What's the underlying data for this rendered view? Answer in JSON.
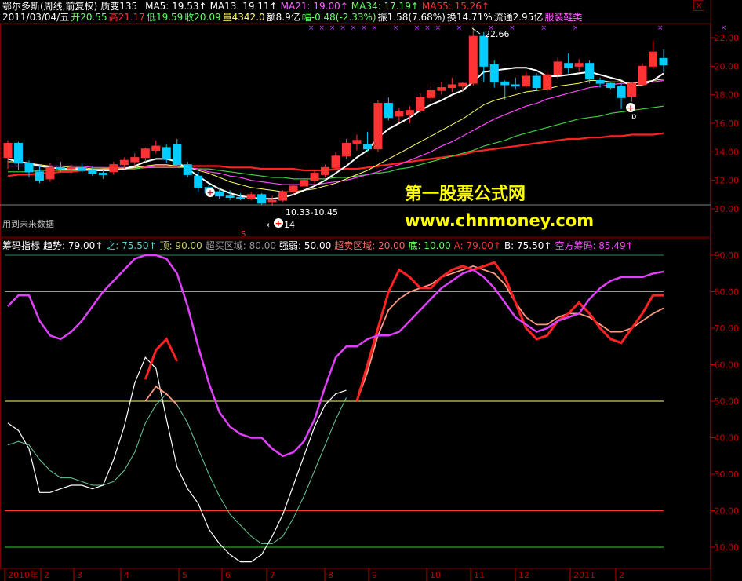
{
  "header1": {
    "name": "鄂尔多斯(周线,前复权)",
    "zhibian": "质变135",
    "ma5": "MA5: 19.53↑",
    "ma13": "MA13: 19.11↑",
    "ma21": "MA21: 19.00↑",
    "ma34": "MA34: 17.19↑",
    "ma55": "MA55: 15.26↑"
  },
  "header2": {
    "date": "2011/03/04/五",
    "open": "开20.55",
    "high": "高21.17",
    "low": "低19.59",
    "close": "收20.09",
    "volume": "量4342.0",
    "amount": "额8.9亿",
    "change": "幅-0.48(-2.33%)",
    "amplitude": "振1.58(7.68%)",
    "turnover": "换14.71%",
    "float": "流通2.95亿",
    "sector": "服装鞋类"
  },
  "price_panel": {
    "yticks": [
      "22.00",
      "20.00",
      "18.00",
      "16.00",
      "14.00",
      "12.00",
      "10.00"
    ],
    "annotation_high": "22.66",
    "annotation_range": "10.33-10.45",
    "annotation_low": "14",
    "future_note": "用到未来数据",
    "marker_s": "S"
  },
  "header3": {
    "indicator": "筹码指标",
    "trend": "趋势: 79.00↑",
    "zhi": "之: 75.50↑",
    "top": "顶: 90.00",
    "overbought": "超买区域: 80.00",
    "strength": "强弱: 50.00",
    "oversold": "超卖区域: 20.00",
    "bottom": "底: 10.00",
    "a": "A: 79.00↑",
    "b": "B: 75.50↑",
    "bear": "空方筹码: 85.49↑"
  },
  "indicator_panel": {
    "yticks": [
      "90.00",
      "80.00",
      "70.00",
      "60.00",
      "50.00",
      "40.00",
      "30.00",
      "20.00",
      "10.00"
    ]
  },
  "xaxis": {
    "labels": [
      "2010年",
      "2",
      "3",
      "4",
      "5",
      "6",
      "7",
      "8",
      "9",
      "10",
      "11",
      "12",
      "2011",
      "2"
    ]
  },
  "watermark": {
    "line1": "第一股票公式网",
    "line2": "www.chnmoney.com"
  },
  "colors": {
    "up": "#ff3333",
    "down": "#00ccff",
    "ma5": "#ffffff",
    "ma13": "#ffff66",
    "ma21": "#ff44ff",
    "ma34": "#44cc44",
    "ma55": "#ff2222",
    "trend": "#ff2222",
    "zhi": "#ff9980",
    "bear": "#e040fb",
    "white_line": "#ffffff",
    "teal_line": "#66cc99"
  },
  "chart_data": [
    {
      "type": "candlestick",
      "title": "鄂尔多斯(周线,前复权)",
      "ylim": [
        9.5,
        23.0
      ],
      "ohlc": [
        [
          13.6,
          14.8,
          12.8,
          14.6
        ],
        [
          14.6,
          14.7,
          12.7,
          13.2
        ],
        [
          13.2,
          13.4,
          12.2,
          12.6
        ],
        [
          12.6,
          13.0,
          11.8,
          12.0
        ],
        [
          12.1,
          13.2,
          11.9,
          12.9
        ],
        [
          12.9,
          13.3,
          12.6,
          12.8
        ],
        [
          12.8,
          13.1,
          12.5,
          12.9
        ],
        [
          12.9,
          13.2,
          12.6,
          12.7
        ],
        [
          12.7,
          13.0,
          12.3,
          12.5
        ],
        [
          12.5,
          12.7,
          12.1,
          12.4
        ],
        [
          12.6,
          13.3,
          12.4,
          13.1
        ],
        [
          13.1,
          13.6,
          12.8,
          13.4
        ],
        [
          13.3,
          13.9,
          13.0,
          13.6
        ],
        [
          13.6,
          14.3,
          13.3,
          14.2
        ],
        [
          14.1,
          14.8,
          13.9,
          14.4
        ],
        [
          14.3,
          14.5,
          13.2,
          13.5
        ],
        [
          14.5,
          14.9,
          13.0,
          13.1
        ],
        [
          13.1,
          13.3,
          12.2,
          12.4
        ],
        [
          12.3,
          12.6,
          11.2,
          11.5
        ],
        [
          11.5,
          11.7,
          10.9,
          11.1
        ],
        [
          11.2,
          11.5,
          10.7,
          10.9
        ],
        [
          10.9,
          11.3,
          10.6,
          10.8
        ],
        [
          10.8,
          11.1,
          10.6,
          10.7
        ],
        [
          10.7,
          11.2,
          10.6,
          11.0
        ],
        [
          11.0,
          11.1,
          10.3,
          10.4
        ],
        [
          10.5,
          10.9,
          10.2,
          10.6
        ],
        [
          10.6,
          11.3,
          10.5,
          11.2
        ],
        [
          11.2,
          11.7,
          11.0,
          11.6
        ],
        [
          11.6,
          12.1,
          11.4,
          12.0
        ],
        [
          12.0,
          12.7,
          11.8,
          12.5
        ],
        [
          12.4,
          13.1,
          12.2,
          12.9
        ],
        [
          12.9,
          14.0,
          12.7,
          13.7
        ],
        [
          13.7,
          14.9,
          13.5,
          14.6
        ],
        [
          14.6,
          15.2,
          14.1,
          14.8
        ],
        [
          14.5,
          15.4,
          14.0,
          14.2
        ],
        [
          14.2,
          17.6,
          14.0,
          17.4
        ],
        [
          17.4,
          17.8,
          16.2,
          16.4
        ],
        [
          16.5,
          17.1,
          16.1,
          16.8
        ],
        [
          16.6,
          17.2,
          16.0,
          16.9
        ],
        [
          16.9,
          18.1,
          16.7,
          17.8
        ],
        [
          17.8,
          18.6,
          17.5,
          18.3
        ],
        [
          18.3,
          18.9,
          18.0,
          18.5
        ],
        [
          18.5,
          19.2,
          18.2,
          18.7
        ],
        [
          18.6,
          18.9,
          18.2,
          18.8
        ],
        [
          18.8,
          22.7,
          18.6,
          22.1
        ],
        [
          22.1,
          22.4,
          18.9,
          20.0
        ],
        [
          20.1,
          20.4,
          18.5,
          18.9
        ],
        [
          18.9,
          19.0,
          17.6,
          18.7
        ],
        [
          18.7,
          19.2,
          18.4,
          18.6
        ],
        [
          18.6,
          19.6,
          18.5,
          19.3
        ],
        [
          19.3,
          19.5,
          18.3,
          18.5
        ],
        [
          18.4,
          19.7,
          18.2,
          19.4
        ],
        [
          19.4,
          20.6,
          19.1,
          20.3
        ],
        [
          20.2,
          20.9,
          19.5,
          19.9
        ],
        [
          20.0,
          20.5,
          19.6,
          20.2
        ],
        [
          20.2,
          20.4,
          18.8,
          19.1
        ],
        [
          19.0,
          19.2,
          18.5,
          18.8
        ],
        [
          18.8,
          18.9,
          18.4,
          18.5
        ],
        [
          18.6,
          18.8,
          17.0,
          17.8
        ],
        [
          17.9,
          18.9,
          17.5,
          18.8
        ],
        [
          18.7,
          20.2,
          18.6,
          20.0
        ],
        [
          20.0,
          21.8,
          19.8,
          21.0
        ],
        [
          20.55,
          21.17,
          19.59,
          20.09
        ]
      ],
      "ma5": [
        13.5,
        13.3,
        13.2,
        13.0,
        12.9,
        12.8,
        12.8,
        12.8,
        12.7,
        12.7,
        12.7,
        12.8,
        13.0,
        13.3,
        13.5,
        13.5,
        13.3,
        12.8,
        12.3,
        11.8,
        11.4,
        11.1,
        10.9,
        10.8,
        10.7,
        10.7,
        10.8,
        11.0,
        11.3,
        11.6,
        12.0,
        12.5,
        13.0,
        13.6,
        14.1,
        15.0,
        15.6,
        16.0,
        16.4,
        16.9,
        17.3,
        17.6,
        18.0,
        18.3,
        18.9,
        19.6,
        19.7,
        19.8,
        19.9,
        19.9,
        19.7,
        19.3,
        19.3,
        19.4,
        19.5,
        19.6,
        19.4,
        19.2,
        19.0,
        18.6,
        18.7,
        19.0,
        19.5
      ],
      "ma13": [
        13.3,
        13.3,
        13.2,
        13.1,
        13.0,
        13.0,
        12.9,
        12.9,
        12.8,
        12.8,
        12.8,
        12.8,
        12.9,
        13.0,
        13.1,
        13.1,
        13.0,
        12.9,
        12.7,
        12.5,
        12.2,
        11.9,
        11.7,
        11.5,
        11.4,
        11.3,
        11.2,
        11.2,
        11.3,
        11.4,
        11.6,
        11.8,
        12.1,
        12.4,
        12.7,
        13.1,
        13.5,
        13.9,
        14.3,
        14.7,
        15.1,
        15.5,
        15.9,
        16.3,
        16.8,
        17.3,
        17.6,
        17.8,
        18.0,
        18.2,
        18.3,
        18.4,
        18.6,
        18.7,
        18.8,
        19.0,
        19.0,
        18.9,
        18.9,
        18.8,
        18.9,
        19.0,
        19.1
      ],
      "ma21": [
        13.0,
        13.0,
        13.0,
        13.0,
        13.0,
        13.0,
        13.0,
        13.0,
        12.9,
        12.9,
        12.9,
        12.9,
        12.9,
        12.9,
        13.0,
        13.0,
        13.0,
        12.9,
        12.8,
        12.6,
        12.5,
        12.3,
        12.2,
        12.0,
        11.9,
        11.8,
        11.7,
        11.7,
        11.7,
        11.7,
        11.8,
        11.9,
        12.0,
        12.2,
        12.4,
        12.6,
        12.9,
        13.1,
        13.4,
        13.7,
        14.0,
        14.4,
        14.7,
        15.1,
        15.5,
        15.9,
        16.3,
        16.6,
        16.9,
        17.2,
        17.4,
        17.7,
        17.9,
        18.1,
        18.3,
        18.5,
        18.6,
        18.7,
        18.8,
        18.8,
        18.9,
        18.9,
        19.0
      ],
      "ma34": [
        12.6,
        12.6,
        12.6,
        12.7,
        12.7,
        12.7,
        12.7,
        12.7,
        12.8,
        12.8,
        12.8,
        12.8,
        12.8,
        12.9,
        12.9,
        12.9,
        12.9,
        12.9,
        12.8,
        12.8,
        12.7,
        12.6,
        12.5,
        12.4,
        12.3,
        12.2,
        12.2,
        12.1,
        12.1,
        12.1,
        12.1,
        12.2,
        12.2,
        12.3,
        12.4,
        12.5,
        12.6,
        12.8,
        12.9,
        13.1,
        13.3,
        13.5,
        13.7,
        13.9,
        14.1,
        14.4,
        14.6,
        14.8,
        15.1,
        15.3,
        15.5,
        15.7,
        15.9,
        16.1,
        16.3,
        16.4,
        16.5,
        16.7,
        16.8,
        16.9,
        17.0,
        17.1,
        17.2
      ],
      "ma55": [
        12.3,
        12.4,
        12.4,
        12.5,
        12.5,
        12.6,
        12.6,
        12.7,
        12.7,
        12.8,
        12.8,
        12.8,
        12.9,
        12.9,
        13.0,
        13.0,
        13.0,
        13.0,
        13.0,
        13.0,
        13.0,
        12.9,
        12.9,
        12.9,
        12.8,
        12.8,
        12.8,
        12.8,
        12.7,
        12.7,
        12.7,
        12.8,
        12.8,
        12.8,
        12.9,
        13.0,
        13.1,
        13.2,
        13.3,
        13.4,
        13.5,
        13.6,
        13.7,
        13.8,
        14.0,
        14.1,
        14.2,
        14.3,
        14.4,
        14.5,
        14.6,
        14.7,
        14.8,
        14.9,
        14.9,
        15.0,
        15.0,
        15.1,
        15.1,
        15.2,
        15.2,
        15.2,
        15.3
      ]
    },
    {
      "type": "line",
      "title": "筹码指标",
      "ylim": [
        5,
        92
      ],
      "reference_lines": [
        90,
        80,
        50,
        20,
        10
      ],
      "series": [
        {
          "name": "空方筹码",
          "values": [
            76,
            79,
            79,
            72,
            68,
            67,
            69,
            72,
            76,
            80,
            83,
            86,
            89,
            90,
            90,
            89,
            85,
            76,
            65,
            55,
            47,
            43,
            41,
            40,
            40,
            37,
            35,
            36,
            39,
            45,
            54,
            62,
            65,
            65,
            67,
            68,
            68,
            69,
            72,
            75,
            78,
            81,
            83,
            85,
            86,
            84,
            81,
            77,
            73,
            71,
            69,
            70,
            72,
            73,
            74,
            78,
            81,
            83,
            84,
            84,
            84,
            85,
            85.49
          ]
        },
        {
          "name": "A",
          "values": [
            null,
            null,
            null,
            null,
            null,
            null,
            null,
            null,
            null,
            null,
            null,
            null,
            null,
            null,
            null,
            null,
            null,
            null,
            null,
            null,
            null,
            null,
            null,
            null,
            null,
            null,
            null,
            null,
            null,
            null,
            null,
            null,
            null,
            50,
            60,
            70,
            80,
            86,
            84,
            81,
            81,
            84,
            86,
            87,
            86,
            87,
            88,
            84,
            77,
            70,
            67,
            68,
            72,
            74,
            77,
            74,
            70,
            67,
            66,
            70,
            74,
            79,
            79
          ]
        },
        {
          "name": "B",
          "values": [
            null,
            null,
            null,
            null,
            null,
            null,
            null,
            null,
            null,
            null,
            null,
            null,
            null,
            null,
            null,
            null,
            null,
            null,
            null,
            null,
            null,
            null,
            null,
            null,
            null,
            null,
            null,
            null,
            null,
            null,
            null,
            null,
            null,
            50,
            58,
            68,
            75,
            78,
            80,
            81,
            82,
            84,
            85,
            86,
            87,
            86,
            85,
            82,
            77,
            73,
            71,
            71,
            73,
            74,
            74,
            73,
            71,
            69,
            69,
            70,
            72,
            74,
            75.5
          ]
        },
        {
          "name": "趋势",
          "values": [
            null,
            null,
            null,
            null,
            null,
            null,
            null,
            null,
            null,
            null,
            null,
            null,
            null,
            56,
            64,
            67,
            61
          ]
        },
        {
          "name": "之",
          "values": [
            null,
            null,
            null,
            null,
            null,
            null,
            null,
            null,
            null,
            null,
            null,
            null,
            null,
            50,
            54,
            52,
            49
          ]
        },
        {
          "name": "white",
          "values": [
            44,
            42,
            37,
            25,
            25,
            26,
            27,
            27,
            26,
            27,
            34,
            43,
            55,
            62,
            59,
            45,
            32,
            26,
            22,
            15,
            11,
            8,
            6,
            6,
            8,
            13,
            19,
            27,
            35,
            43,
            49,
            52,
            53
          ]
        },
        {
          "name": "teal",
          "values": [
            38,
            39,
            38,
            34,
            31,
            29,
            29,
            28,
            27,
            27,
            28,
            31,
            36,
            44,
            49,
            52,
            49,
            44,
            37,
            30,
            24,
            19,
            16,
            13,
            11,
            11,
            13,
            18,
            24,
            31,
            38,
            45,
            51
          ]
        }
      ]
    }
  ]
}
